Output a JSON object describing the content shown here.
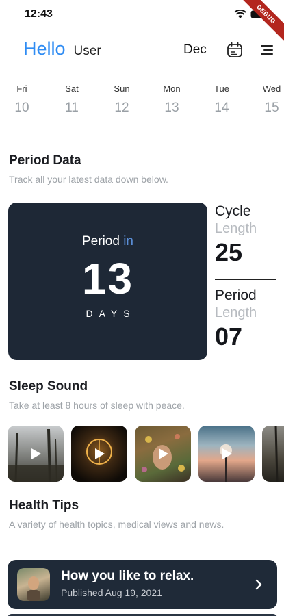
{
  "status": {
    "time": "12:43",
    "banner": "DEBUG"
  },
  "header": {
    "hello": "Hello",
    "user": "User",
    "month": "Dec",
    "icons": [
      "calendar-icon",
      "menu-icon"
    ],
    "accent": "#2f8cf3"
  },
  "week": [
    {
      "name": "Fri",
      "num": "10"
    },
    {
      "name": "Sat",
      "num": "11"
    },
    {
      "name": "Sun",
      "num": "12"
    },
    {
      "name": "Mon",
      "num": "13"
    },
    {
      "name": "Tue",
      "num": "14"
    },
    {
      "name": "Wed",
      "num": "15"
    }
  ],
  "period_section": {
    "title": "Period Data",
    "subtitle": "Track all your latest data down below.",
    "card": {
      "label": "Period",
      "in": "in",
      "number": "13",
      "unit": "DAYS",
      "bg": "#1e2836"
    },
    "cycle": {
      "title": "Cycle",
      "sub": "Length",
      "value": "25"
    },
    "period": {
      "title": "Period",
      "sub": "Length",
      "value": "07"
    }
  },
  "sleep_section": {
    "title": "Sleep Sound",
    "subtitle": "Take at least 8 hours of sleep with peace.",
    "items": [
      "forest",
      "candle",
      "flower-face",
      "sunset",
      "woods"
    ]
  },
  "health_section": {
    "title": "Health Tips",
    "subtitle": "A variety of health topics, medical views and news.",
    "tip": {
      "title": "How you like to relax.",
      "date": "Published Aug 19, 2021"
    }
  }
}
